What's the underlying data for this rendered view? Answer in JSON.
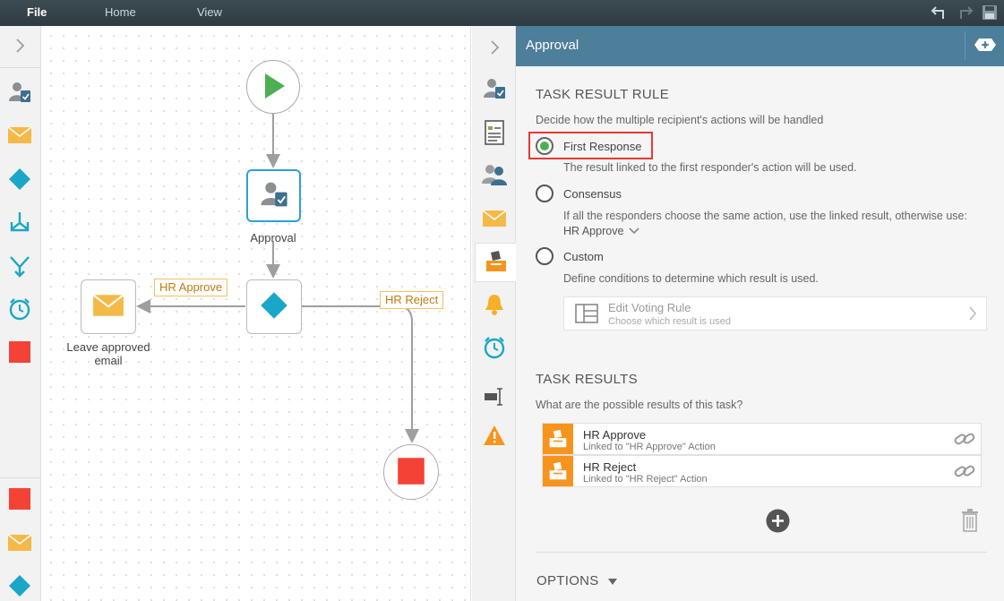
{
  "menu": {
    "file": "File",
    "home": "Home",
    "view": "View"
  },
  "workflow": {
    "approval_label": "Approval",
    "leave_label_line1": "Leave approved",
    "leave_label_line2": "email",
    "tag_approve": "HR Approve",
    "tag_reject": "HR Reject"
  },
  "panel": {
    "title": "Approval",
    "task_result_rule": {
      "heading": "TASK RESULT RULE",
      "description": "Decide how the multiple recipient's actions will be handled",
      "options": [
        {
          "label": "First Response",
          "desc": "The result linked to the first responder's action will be used.",
          "selected": true
        },
        {
          "label": "Consensus",
          "desc": "If all the responders choose the same action, use the linked result, otherwise use:",
          "fallback": "HR Approve"
        },
        {
          "label": "Custom",
          "desc": "Define conditions to determine which result is used."
        }
      ],
      "voting_rule": {
        "title": "Edit Voting Rule",
        "subtitle": "Choose which result is used"
      }
    },
    "task_results": {
      "heading": "TASK RESULTS",
      "description": "What are the possible results of this task?",
      "items": [
        {
          "name": "HR Approve",
          "link": "Linked to \"HR Approve\" Action"
        },
        {
          "name": "HR Reject",
          "link": "Linked to \"HR Reject\" Action"
        }
      ]
    },
    "options_label": "OPTIONS"
  },
  "colors": {
    "accent": "#4d7e9a",
    "orange": "#f7941d",
    "green": "#4caf50",
    "red": "#f44336",
    "teal": "#1aa7c7"
  }
}
